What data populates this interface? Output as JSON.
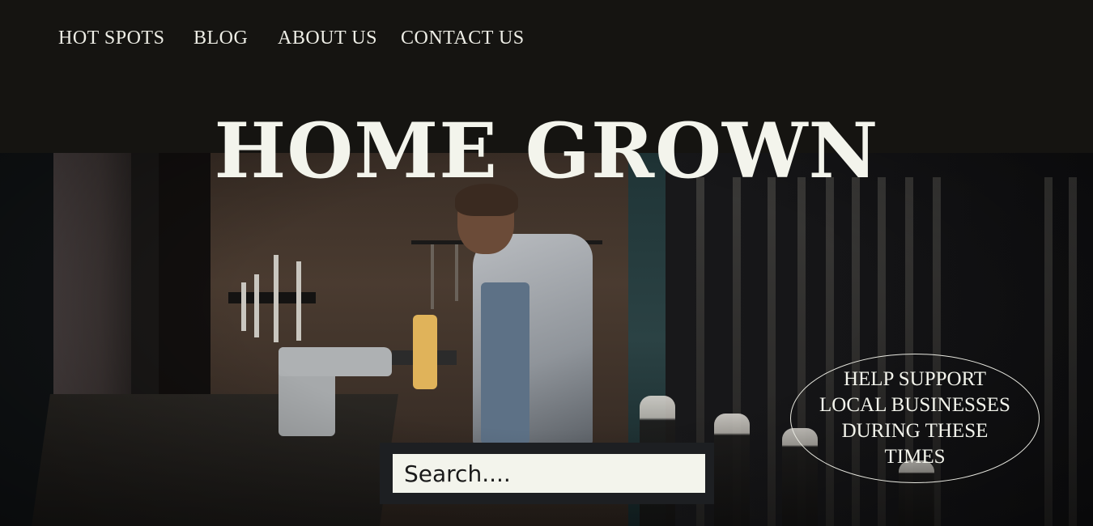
{
  "nav": {
    "items": [
      {
        "label": "HOT SPOTS"
      },
      {
        "label": "BLOG"
      },
      {
        "label": "ABOUT US"
      },
      {
        "label": "CONTACT US"
      }
    ]
  },
  "hero": {
    "title": "HOME GROWN"
  },
  "search": {
    "placeholder": "Search...."
  },
  "badge": {
    "text": "HELP SUPPORT LOCAL BUSINESSES DURING THESE TIMES"
  },
  "colors": {
    "header_bg": "#151411",
    "text_light": "#f3f4ec",
    "search_frame": "#1d1f22"
  }
}
